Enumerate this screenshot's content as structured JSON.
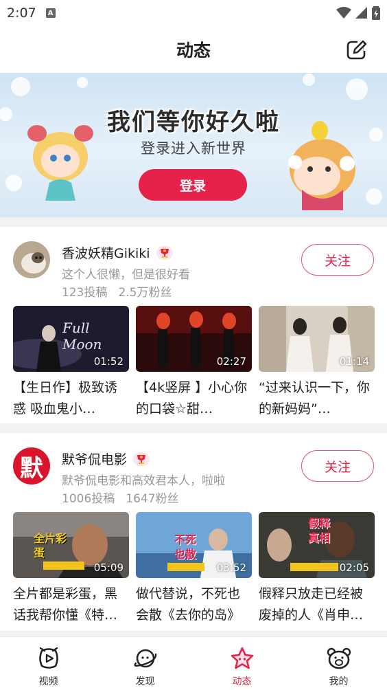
{
  "status_bar": {
    "time": "2:07",
    "notification_icon": "A"
  },
  "header": {
    "title": "动态",
    "edit_icon": "edit-icon"
  },
  "banner": {
    "title": "我们等你好久啦",
    "subtitle": "登录进入新世界",
    "login_label": "登录"
  },
  "feed": [
    {
      "username": "香波妖精Gikiki",
      "description": "这个人很懒，但是很好看",
      "posts": "123投稿",
      "fans": "2.5万粉丝",
      "follow_label": "关注",
      "videos": [
        {
          "title": "【生日作】极致诱惑 吸血鬼小…",
          "duration": "01:52",
          "thumb_text": "Full Moon"
        },
        {
          "title": "【4k竖屏 】小心你的口袋☆甜…",
          "duration": "02:27",
          "thumb_text": ""
        },
        {
          "title": "“过来认识一下，你的新妈妈”…",
          "duration": "01:14",
          "thumb_text": ""
        }
      ]
    },
    {
      "username": "默爷侃电影",
      "avatar_text": "默",
      "description": "默爷侃电影和高效君本人，啦啦",
      "posts": "1006投稿",
      "fans": "1647粉丝",
      "follow_label": "关注",
      "videos": [
        {
          "title": "全片都是彩蛋，黑话我帮你懂《特…",
          "duration": "05:09",
          "thumb_text": "全片彩蛋"
        },
        {
          "title": "做代替说，不死也会散《去你的岛》",
          "duration": "03:52",
          "thumb_text": "不死也散"
        },
        {
          "title": "假释只放走已经被废掉的人《肖申…",
          "duration": "02:05",
          "thumb_text": "假释真相"
        }
      ]
    }
  ],
  "tabs": [
    {
      "label": "视频",
      "icon": "video-icon",
      "active": false
    },
    {
      "label": "发现",
      "icon": "planet-icon",
      "active": false
    },
    {
      "label": "动态",
      "icon": "star-icon",
      "active": true
    },
    {
      "label": "我的",
      "icon": "bear-icon",
      "active": false
    }
  ],
  "colors": {
    "accent": "#e6224a",
    "muted_text": "#999999",
    "background": "#f2f2f2"
  }
}
